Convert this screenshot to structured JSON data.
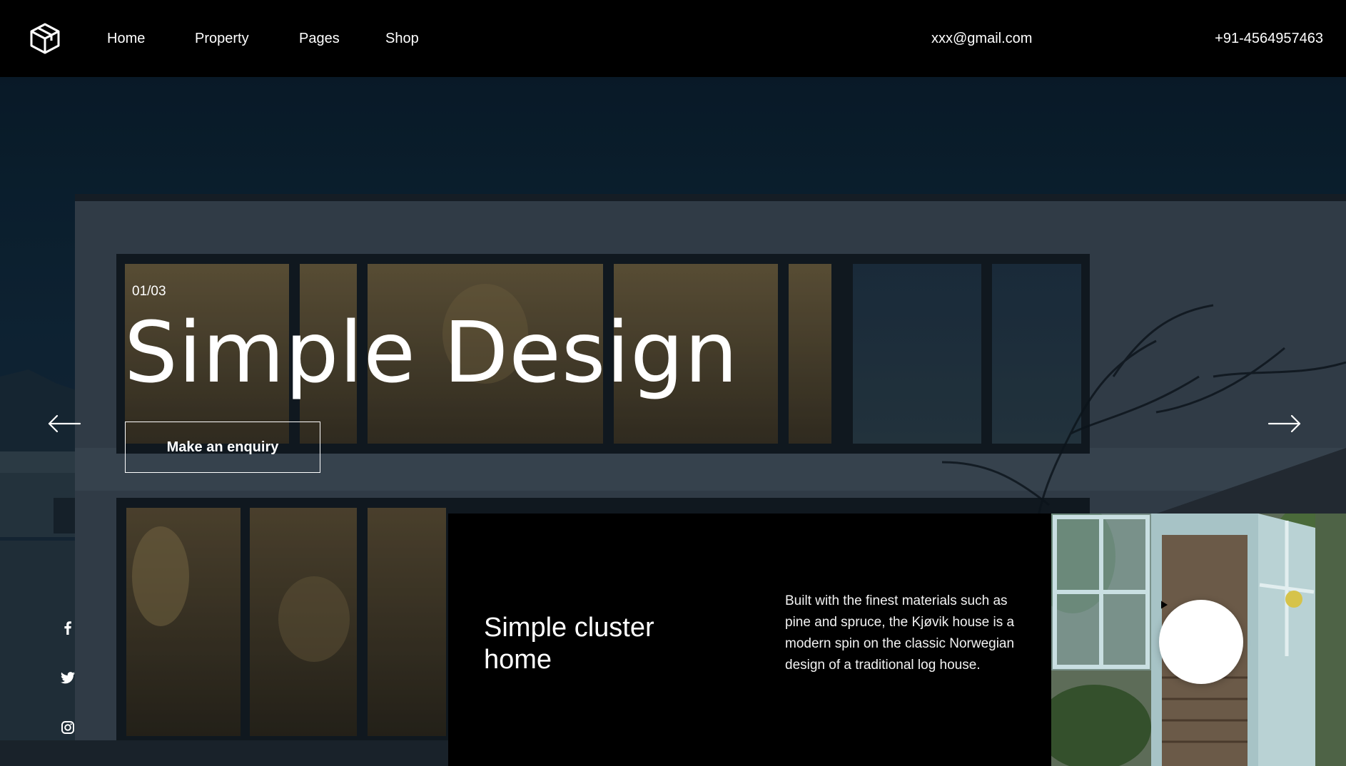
{
  "header": {
    "logo_icon": "cube-logo-icon",
    "nav": [
      "Home",
      "Property",
      "Pages",
      "Shop"
    ],
    "email": "xxx@gmail.com",
    "phone": "+91-4564957463"
  },
  "hero": {
    "slide_counter": "01/03",
    "title": "Simple Design",
    "cta_label": "Make an enquiry",
    "prev_icon": "arrow-left-icon",
    "next_icon": "arrow-right-icon",
    "social_icons": [
      "facebook-icon",
      "twitter-icon",
      "instagram-icon"
    ]
  },
  "card": {
    "title_line1": "Simple cluster",
    "title_line2": "home",
    "description": "Built with the finest materials such as pine and spruce, the Kjøvik house is a modern spin on the classic Norwegian design of a traditional log house."
  },
  "thumbnail": {
    "play_icon": "play-icon"
  },
  "colors": {
    "background": "#000000",
    "text": "#ffffff",
    "sky": "#0e2333"
  }
}
